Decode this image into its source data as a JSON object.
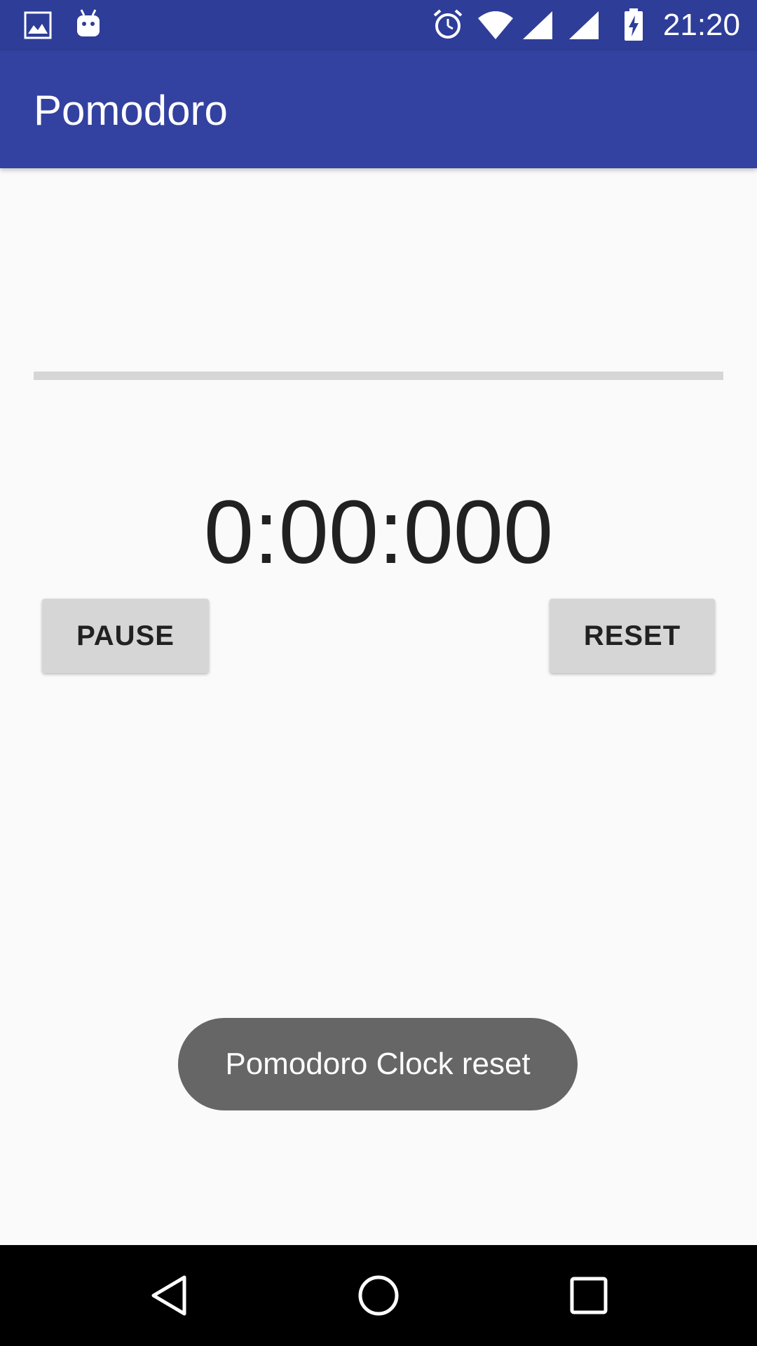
{
  "status_bar": {
    "time": "21:20",
    "icons": [
      "image-icon",
      "android-icon",
      "alarm-icon",
      "wifi-icon",
      "signal-icon",
      "signal-icon",
      "battery-charging-icon"
    ]
  },
  "app_bar": {
    "title": "Pomodoro"
  },
  "progress": {
    "value": 0
  },
  "timer": {
    "display": "0:00:000"
  },
  "buttons": {
    "pause_label": "PAUSE",
    "reset_label": "RESET"
  },
  "toast": {
    "message": "Pomodoro Clock reset"
  },
  "nav_bar": {
    "icons": [
      "back-icon",
      "home-icon",
      "recents-icon"
    ]
  },
  "colors": {
    "status_bar": "#2e3d98",
    "app_bar": "#3341a0",
    "background": "#fafafa",
    "button": "#d6d6d6",
    "toast": "#666666",
    "nav_bar": "#000000"
  }
}
